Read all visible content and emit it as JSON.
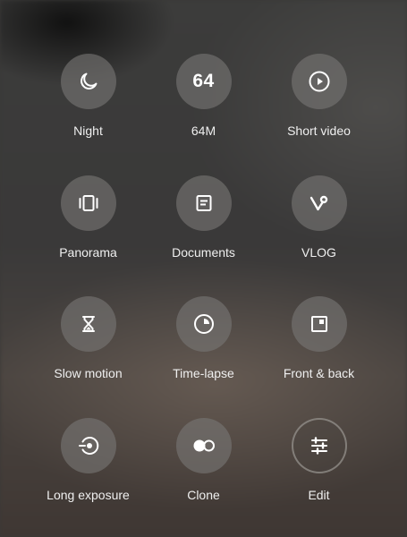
{
  "modes": [
    {
      "label": "Night",
      "icon": "moon-icon"
    },
    {
      "label": "64M",
      "icon": "64m-icon",
      "icon_text": "64"
    },
    {
      "label": "Short video",
      "icon": "play-circle-icon"
    },
    {
      "label": "Panorama",
      "icon": "panorama-icon"
    },
    {
      "label": "Documents",
      "icon": "document-icon"
    },
    {
      "label": "VLOG",
      "icon": "vlog-icon"
    },
    {
      "label": "Slow motion",
      "icon": "hourglass-icon"
    },
    {
      "label": "Time-lapse",
      "icon": "timer-icon"
    },
    {
      "label": "Front & back",
      "icon": "front-back-icon"
    },
    {
      "label": "Long exposure",
      "icon": "long-exposure-icon"
    },
    {
      "label": "Clone",
      "icon": "clone-icon"
    },
    {
      "label": "Edit",
      "icon": "sliders-icon"
    }
  ],
  "colors": {
    "button_fill": "#7a7876",
    "text": "#efefef"
  }
}
